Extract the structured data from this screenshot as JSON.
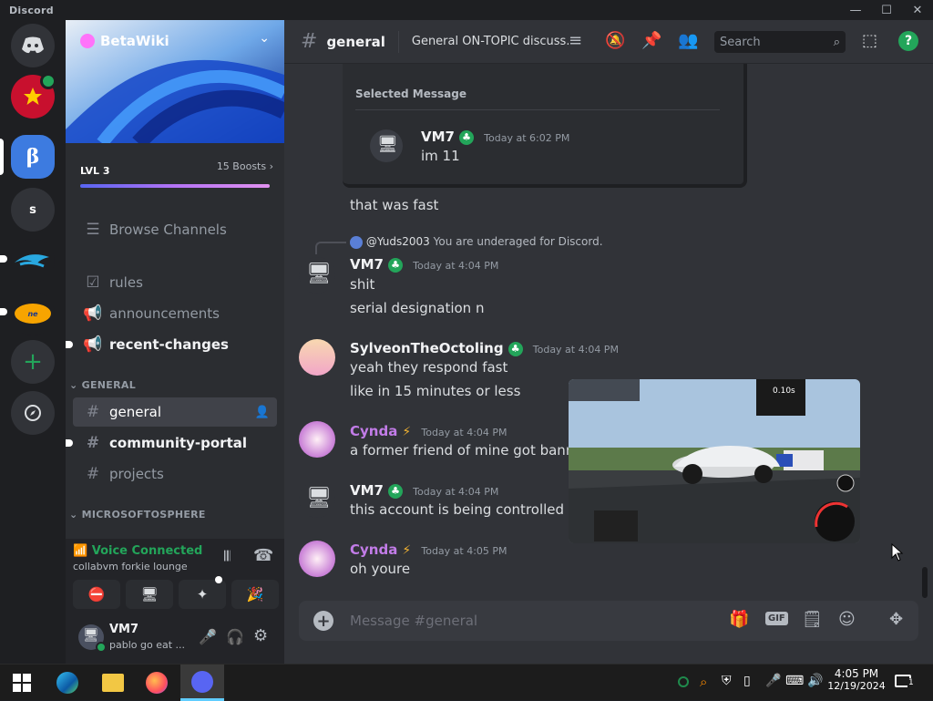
{
  "app": {
    "title": "Discord"
  },
  "window": {
    "minimize": "—",
    "maximize": "☐",
    "close": "✕"
  },
  "server": {
    "name": "BetaWiki",
    "level": "LVL 3",
    "boosts": "15 Boosts",
    "boost_progress": 0.98
  },
  "sidebar": {
    "browse": "Browse Channels",
    "channels_top": [
      {
        "name": "rules",
        "icon": "rules-icon"
      },
      {
        "name": "announcements",
        "icon": "megaphone-icon"
      },
      {
        "name": "recent-changes",
        "icon": "megaphone-icon",
        "unread": true
      }
    ],
    "category_general": "GENERAL",
    "channels_general": [
      {
        "name": "general",
        "active": true
      },
      {
        "name": "community-portal",
        "unread": true
      },
      {
        "name": "projects"
      }
    ],
    "category_msft": "MICROSOFTOSPHERE"
  },
  "voice": {
    "status": "Voice Connected",
    "subtitle": "collabvm forkie lounge"
  },
  "user": {
    "name": "VM7",
    "status": "pablo go eat ..."
  },
  "header": {
    "channel": "general",
    "topic": "General ON-TOPIC discuss...",
    "search_placeholder": "Search"
  },
  "messages": {
    "selected_label": "Selected Message",
    "selected": {
      "author": "VM7",
      "time": "Today at 6:02 PM",
      "text": "im 11"
    },
    "m1": "that was fast",
    "reply": {
      "mention": "@Yuds2003",
      "text": "You are underaged for Discord."
    },
    "g1": {
      "author": "VM7",
      "time": "Today at 4:04 PM",
      "lines": [
        "shit",
        "serial designation n"
      ]
    },
    "g2": {
      "author": "SylveonTheOctoling",
      "time": "Today at 4:04 PM",
      "lines": [
        "yeah they respond fast",
        "like in 15 minutes or less"
      ]
    },
    "g3": {
      "author": "Cynda",
      "time": "Today at 4:04 PM",
      "lines": [
        "a former friend of mine got banned"
      ]
    },
    "g4": {
      "author": "VM7",
      "time": "Today at 4:04 PM",
      "lines": [
        "this account is being controlled by 1"
      ]
    },
    "g5": {
      "author": "Cynda",
      "time": "Today at 4:05 PM",
      "lines": [
        "oh youre"
      ]
    },
    "overlay_timer": "0.10s"
  },
  "composer": {
    "placeholder": "Message #general",
    "gif": "GIF"
  },
  "taskbar": {
    "time": "4:05 PM",
    "date": "12/19/2024",
    "notif_count": "1"
  },
  "colors": {
    "accent": "#5865f2",
    "online": "#23a55a",
    "cynda": "#c27ce8"
  }
}
